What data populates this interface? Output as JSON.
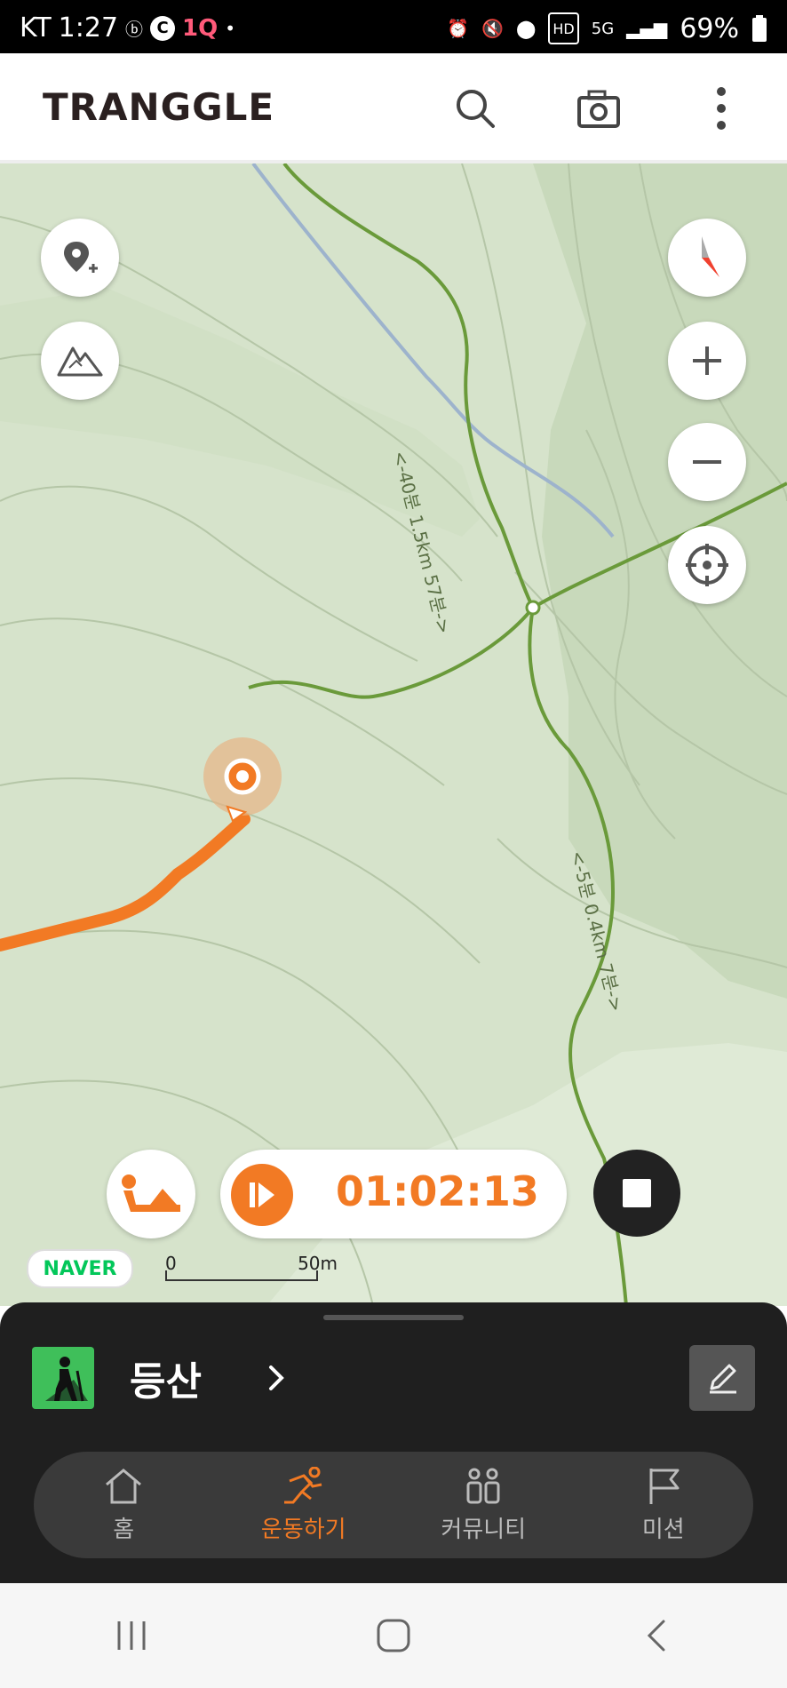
{
  "status": {
    "carrier": "KT",
    "time": "1:27",
    "battery": "69%",
    "network": "5G"
  },
  "app": {
    "logo": "TRANGGLE"
  },
  "map": {
    "trail_labels": [
      "<-40분 1.5km 57분->",
      "<-5분 0.4km 7분->"
    ],
    "scale_start": "0",
    "scale_end": "50m",
    "provider": "NAVER"
  },
  "tracking": {
    "timer": "01:02:13"
  },
  "sheet": {
    "activity_label": "등산"
  },
  "tabs": [
    {
      "label": "홈",
      "icon": "home-icon"
    },
    {
      "label": "운동하기",
      "icon": "running-icon"
    },
    {
      "label": "커뮤니티",
      "icon": "community-icon"
    },
    {
      "label": "미션",
      "icon": "flag-icon"
    }
  ],
  "colors": {
    "accent": "#f27a24",
    "map_bg": "#d6e3cb",
    "trail": "#6a9a3a",
    "stream": "#9db3cc",
    "sheet_bg": "#1f1f1f"
  }
}
